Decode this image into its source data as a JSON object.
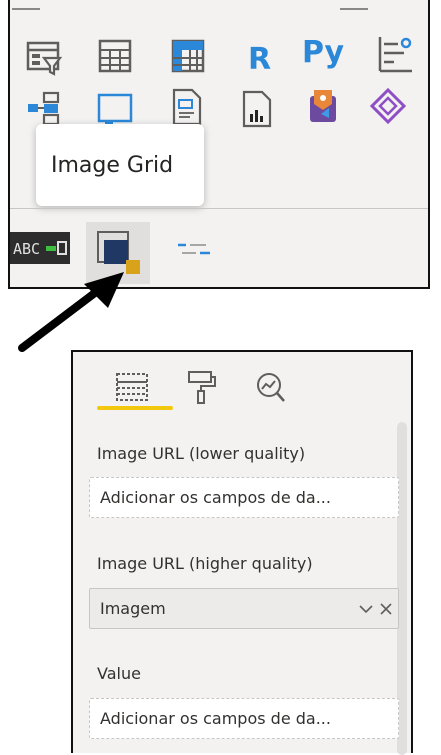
{
  "visualizations": {
    "row1": [
      "slicer-icon",
      "table-icon",
      "matrix-icon",
      "r-visual-icon",
      "python-visual-icon",
      "key-influencers-icon"
    ],
    "row2": [
      "decomposition-tree-icon",
      "qa-icon",
      "paginated-report-icon",
      "smart-narrative-icon",
      "power-apps-icon",
      "power-automate-icon"
    ],
    "r_label": "R",
    "py_label": "Py",
    "tooltip": "Image Grid",
    "bottom_icons": [
      "abc-custom-visual-icon",
      "image-grid-visual-icon",
      "dashes-visual-icon"
    ],
    "abc_text": "ABC"
  },
  "fields_pane": {
    "tabs": [
      "fields-tab-icon",
      "format-tab-icon",
      "analytics-tab-icon"
    ],
    "wells": [
      {
        "label": "Image URL (lower quality)",
        "value": "Adicionar os campos de da...",
        "filled": false
      },
      {
        "label": "Image URL (higher quality)",
        "value": "Imagem",
        "filled": true
      },
      {
        "label": "Value",
        "value": "Adicionar os campos de da...",
        "filled": false
      }
    ]
  },
  "colors": {
    "accent_yellow": "#f2c80f",
    "r_blue": "#2b88d8",
    "navy": "#1f3864",
    "gold": "#d9a21b"
  }
}
